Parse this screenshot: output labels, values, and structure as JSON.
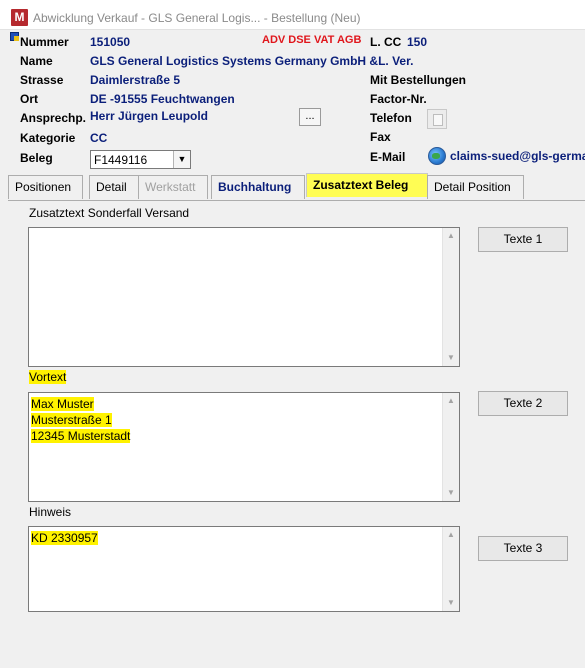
{
  "window": {
    "title": "Abwicklung Verkauf - GLS General Logis... - Bestellung (Neu)",
    "app_icon_letter": "M"
  },
  "header": {
    "nummer_label": "Nummer",
    "nummer_value": "151050",
    "flags": "ADV DSE VAT AGB",
    "lcc_label": "L. CC",
    "lcc_value": "150",
    "name_label": "Name",
    "name_value": "GLS General Logistics Systems Germany GmbH &L. Ver.",
    "strasse_label": "Strasse",
    "strasse_value": "Daimlerstraße 5",
    "mit_bestellungen_label": "Mit Bestellungen",
    "ort_label": "Ort",
    "ort_value": "DE -91555 Feuchtwangen",
    "factor_label": "Factor-Nr.",
    "ansprech_label": "Ansprechp.",
    "ansprech_value": "Herr Jürgen Leupold",
    "more_button": "...",
    "telefon_label": "Telefon",
    "kategorie_label": "Kategorie",
    "kategorie_value": "CC",
    "fax_label": "Fax",
    "beleg_label": "Beleg",
    "beleg_value": "F1449116",
    "email_label": "E-Mail",
    "email_value": "claims-sued@gls-germa"
  },
  "tabs": [
    {
      "label": "Positionen",
      "state": "normal"
    },
    {
      "label": "Detail",
      "state": "normal"
    },
    {
      "label": "Werkstatt",
      "state": "disabled"
    },
    {
      "label": "Buchhaltung",
      "state": "bold"
    },
    {
      "label": "Zusatztext Beleg",
      "state": "active"
    },
    {
      "label": "Detail Position",
      "state": "normal"
    }
  ],
  "sections": {
    "sonderfall": {
      "label": "Zusatztext Sonderfall Versand",
      "lines": [],
      "button": "Texte 1"
    },
    "vortext": {
      "label": "Vortext",
      "lines": [
        "Max Muster",
        "Musterstraße 1",
        "12345 Musterstadt"
      ],
      "button": "Texte 2"
    },
    "hinweis": {
      "label": "Hinweis",
      "lines": [
        "KD 2330957"
      ],
      "button": "Texte 3"
    }
  },
  "colors": {
    "highlight": "#fff200",
    "value_text": "#0b1f7a",
    "flags_text": "#e0161c"
  },
  "icons": {
    "telefon": "phone-icon",
    "email": "globe-icon"
  }
}
